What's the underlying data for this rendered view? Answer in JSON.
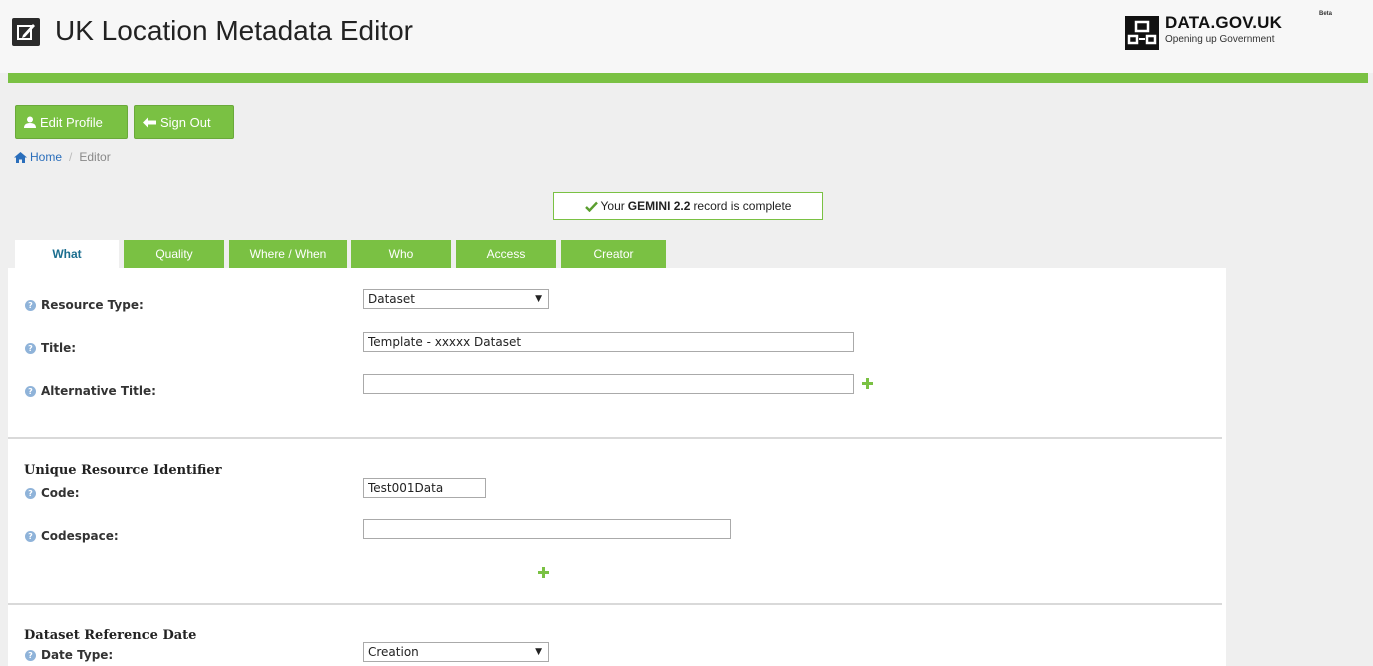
{
  "header": {
    "title": "UK Location Metadata Editor",
    "app_icon": "edit-square-icon",
    "brand_name": "DATA.GOV.UK",
    "brand_tag": "Beta",
    "brand_subtitle": "Opening up Government"
  },
  "toolbar": {
    "edit_profile_label": "Edit Profile",
    "sign_out_label": "Sign Out"
  },
  "breadcrumb": {
    "home": "Home",
    "separator": "/",
    "current": "Editor"
  },
  "status": {
    "prefix": "Your",
    "standard": "GEMINI 2.2",
    "suffix": "record is complete"
  },
  "tabs": [
    "What",
    "Quality",
    "Where / When",
    "Who",
    "Access",
    "Creator"
  ],
  "form": {
    "resource_type_label": "Resource Type:",
    "resource_type_value": "Dataset",
    "title_label": "Title:",
    "title_value": "Template - xxxxx Dataset",
    "alt_title_label": "Alternative Title:",
    "alt_title_value": "",
    "uri_section": "Unique Resource Identifier",
    "code_label": "Code:",
    "code_value": "Test001Data",
    "codespace_label": "Codespace:",
    "codespace_value": "",
    "ref_date_section": "Dataset Reference Date",
    "date_type_label": "Date Type:",
    "date_type_value": "Creation"
  },
  "colors": {
    "accent": "#7ac143",
    "link": "#2a6ebb",
    "active_tab_text": "#1b6e8f"
  }
}
